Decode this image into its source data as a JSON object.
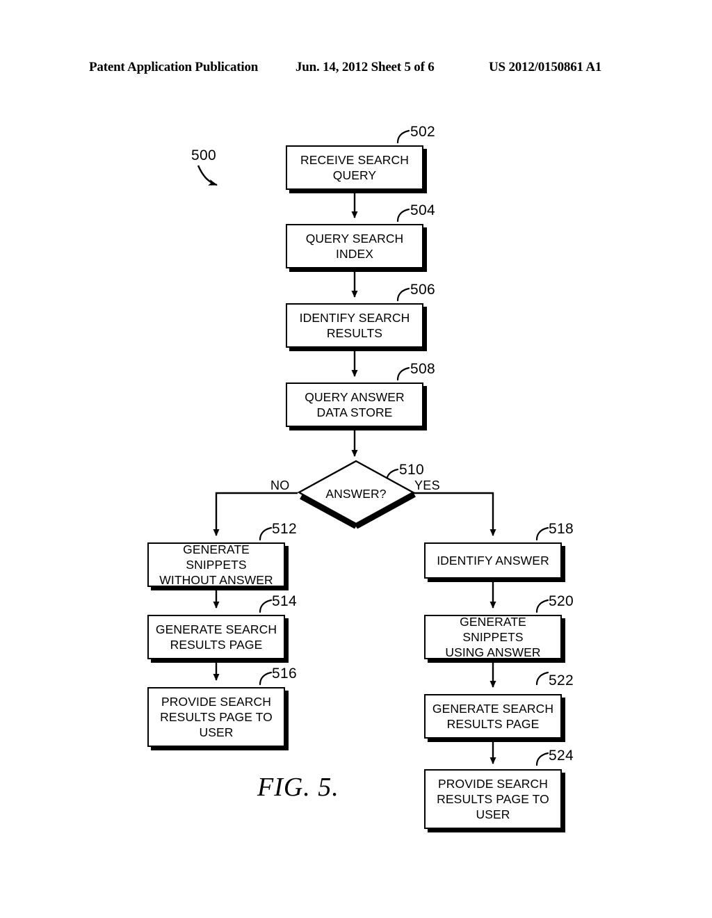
{
  "header": {
    "publication": "Patent Application Publication",
    "date_sheet": "Jun. 14, 2012  Sheet 5 of 6",
    "publication_number": "US 2012/0150861 A1"
  },
  "figure": {
    "caption": "FIG. 5.",
    "diagram_label": "500"
  },
  "flowchart": {
    "type": "flowchart",
    "nodes": [
      {
        "id": "502",
        "ref": "502",
        "shape": "process",
        "text": "RECEIVE SEARCH\nQUERY"
      },
      {
        "id": "504",
        "ref": "504",
        "shape": "process",
        "text": "QUERY SEARCH\nINDEX"
      },
      {
        "id": "506",
        "ref": "506",
        "shape": "process",
        "text": "IDENTIFY SEARCH\nRESULTS"
      },
      {
        "id": "508",
        "ref": "508",
        "shape": "process",
        "text": "QUERY ANSWER\nDATA STORE"
      },
      {
        "id": "510",
        "ref": "510",
        "shape": "decision",
        "text": "ANSWER?"
      },
      {
        "id": "512",
        "ref": "512",
        "shape": "process",
        "text": "GENERATE SNIPPETS\nWITHOUT ANSWER"
      },
      {
        "id": "514",
        "ref": "514",
        "shape": "process",
        "text": "GENERATE SEARCH\nRESULTS PAGE"
      },
      {
        "id": "516",
        "ref": "516",
        "shape": "process",
        "text": "PROVIDE SEARCH\nRESULTS PAGE TO\nUSER"
      },
      {
        "id": "518",
        "ref": "518",
        "shape": "process",
        "text": "IDENTIFY ANSWER"
      },
      {
        "id": "520",
        "ref": "520",
        "shape": "process",
        "text": "GENERATE SNIPPETS\nUSING ANSWER"
      },
      {
        "id": "522",
        "ref": "522",
        "shape": "process",
        "text": "GENERATE SEARCH\nRESULTS PAGE"
      },
      {
        "id": "524",
        "ref": "524",
        "shape": "process",
        "text": "PROVIDE SEARCH\nRESULTS PAGE TO\nUSER"
      }
    ],
    "branch_labels": {
      "no": "NO",
      "yes": "YES"
    },
    "edges": [
      {
        "from": "502",
        "to": "504",
        "label": ""
      },
      {
        "from": "504",
        "to": "506",
        "label": ""
      },
      {
        "from": "506",
        "to": "508",
        "label": ""
      },
      {
        "from": "508",
        "to": "510",
        "label": ""
      },
      {
        "from": "510",
        "to": "512",
        "label": "NO"
      },
      {
        "from": "512",
        "to": "514",
        "label": ""
      },
      {
        "from": "514",
        "to": "516",
        "label": ""
      },
      {
        "from": "510",
        "to": "518",
        "label": "YES"
      },
      {
        "from": "518",
        "to": "520",
        "label": ""
      },
      {
        "from": "520",
        "to": "522",
        "label": ""
      },
      {
        "from": "522",
        "to": "524",
        "label": ""
      }
    ]
  },
  "colors": {
    "ink": "#000000",
    "paper": "#ffffff"
  }
}
